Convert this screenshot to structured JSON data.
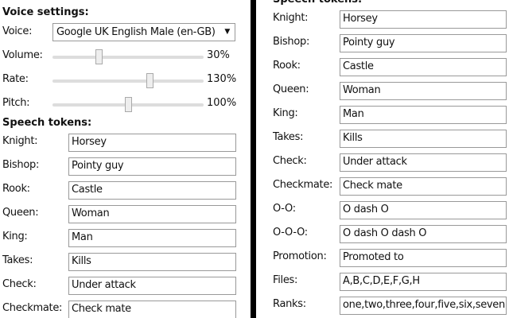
{
  "voice_settings": {
    "title": "Voice settings:",
    "voice_label": "Voice:",
    "voice_value": "Google UK English Male (en-GB)",
    "sliders": [
      {
        "label": "Volume:",
        "value": "30%",
        "fraction": 0.3
      },
      {
        "label": "Rate:",
        "value": "130%",
        "fraction": 0.65
      },
      {
        "label": "Pitch:",
        "value": "100%",
        "fraction": 0.5
      }
    ]
  },
  "speech_tokens_title": "Speech tokens:",
  "tokens": [
    {
      "label": "Knight:",
      "value": "Horsey"
    },
    {
      "label": "Bishop:",
      "value": "Pointy guy"
    },
    {
      "label": "Rook:",
      "value": "Castle"
    },
    {
      "label": "Queen:",
      "value": "Woman"
    },
    {
      "label": "King:",
      "value": "Man"
    },
    {
      "label": "Takes:",
      "value": "Kills"
    },
    {
      "label": "Check:",
      "value": "Under attack"
    },
    {
      "label": "Checkmate:",
      "value": "Check mate"
    },
    {
      "label": "O-O:",
      "value": "O dash O"
    },
    {
      "label": "O-O-O:",
      "value": "O dash O dash O"
    },
    {
      "label": "Promotion:",
      "value": "Promoted to"
    },
    {
      "label": "Files:",
      "value": "A,B,C,D,E,F,G,H"
    },
    {
      "label": "Ranks:",
      "value": "one,two,three,four,five,six,seven,e"
    }
  ]
}
